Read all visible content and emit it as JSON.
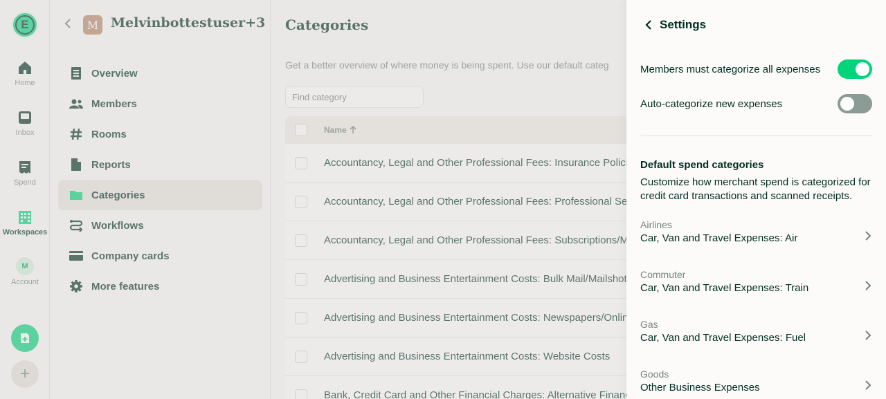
{
  "rail": {
    "logo_letter": "E",
    "items": [
      {
        "label": "Home",
        "icon": "home-icon"
      },
      {
        "label": "Inbox",
        "icon": "inbox-icon"
      },
      {
        "label": "Spend",
        "icon": "receipt-icon"
      },
      {
        "label": "Workspaces",
        "icon": "building-icon"
      },
      {
        "label": "Account",
        "icon": "avatar"
      }
    ],
    "account_initial": "M"
  },
  "workspace": {
    "avatar_letter": "M",
    "name": "Melvinbottestuser+3...",
    "nav": [
      {
        "label": "Overview",
        "icon": "document-icon"
      },
      {
        "label": "Members",
        "icon": "users-icon"
      },
      {
        "label": "Rooms",
        "icon": "hash-icon"
      },
      {
        "label": "Reports",
        "icon": "page-icon"
      },
      {
        "label": "Categories",
        "icon": "folder-icon",
        "active": true
      },
      {
        "label": "Workflows",
        "icon": "workflow-icon"
      },
      {
        "label": "Company cards",
        "icon": "card-icon"
      },
      {
        "label": "More features",
        "icon": "gear-icon"
      }
    ]
  },
  "main": {
    "title": "Categories",
    "description": "Get a better overview of where money is being spent. Use our default categ",
    "search_placeholder": "Find category",
    "name_header": "Name",
    "rows": [
      "Accountancy, Legal and Other Professional Fees: Insurance Policies/",
      "Accountancy, Legal and Other Professional Fees: Professional Servic",
      "Accountancy, Legal and Other Professional Fees: Subscriptions/Mer",
      "Advertising and Business Entertainment Costs: Bulk Mail/Mailshots",
      "Advertising and Business Entertainment Costs: Newspapers/Online",
      "Advertising and Business Entertainment Costs: Website Costs",
      "Bank, Credit Card and Other Financial Charges: Alternative Finance"
    ]
  },
  "settings": {
    "title": "Settings",
    "toggles": [
      {
        "label": "Members must categorize all expenses",
        "on": true
      },
      {
        "label": "Auto-categorize new expenses",
        "on": false
      }
    ],
    "section_title": "Default spend categories",
    "section_desc": "Customize how merchant spend is categorized for credit card transactions and scanned receipts.",
    "categories": [
      {
        "label": "Airlines",
        "value": "Car, Van and Travel Expenses: Air"
      },
      {
        "label": "Commuter",
        "value": "Car, Van and Travel Expenses: Train"
      },
      {
        "label": "Gas",
        "value": "Car, Van and Travel Expenses: Fuel"
      },
      {
        "label": "Goods",
        "value": "Other Business Expenses"
      }
    ]
  },
  "colors": {
    "accent": "#03d47c",
    "text": "#002e22",
    "muted": "#76847e"
  }
}
